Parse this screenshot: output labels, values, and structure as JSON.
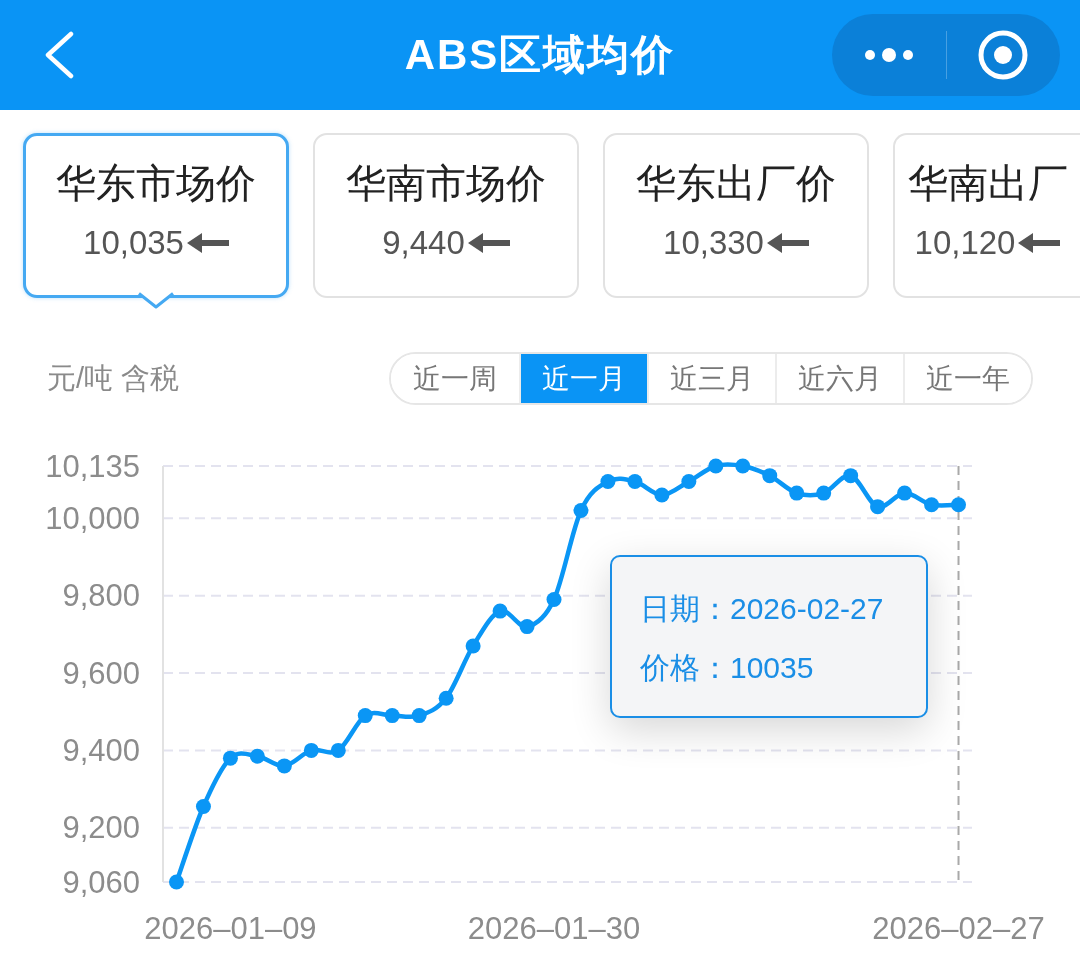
{
  "header": {
    "title": "ABS区域均价"
  },
  "cards": [
    {
      "title": "华东市场价",
      "value": "10,035",
      "selected": true
    },
    {
      "title": "华南市场价",
      "value": "9,440",
      "selected": false
    },
    {
      "title": "华东出厂价",
      "value": "10,330",
      "selected": false
    },
    {
      "title": "华南出厂",
      "value": "10,120",
      "selected": false
    }
  ],
  "unit_label": "元/吨 含税",
  "range_tabs": [
    {
      "label": "近一周",
      "selected": false
    },
    {
      "label": "近一月",
      "selected": true
    },
    {
      "label": "近三月",
      "selected": false
    },
    {
      "label": "近六月",
      "selected": false
    },
    {
      "label": "近一年",
      "selected": false
    }
  ],
  "chart": {
    "chart_data": {
      "type": "line",
      "categories": [
        null,
        null,
        "2026–01–09",
        null,
        null,
        null,
        null,
        null,
        null,
        null,
        null,
        null,
        null,
        null,
        "2026–01–30",
        null,
        null,
        null,
        null,
        null,
        null,
        null,
        null,
        null,
        null,
        null,
        null,
        null,
        null,
        "2026–02–27"
      ],
      "series": [
        {
          "color": "#0a96f5",
          "marker": "circle",
          "values": [
            9060,
            9255,
            9380,
            9385,
            9360,
            9400,
            9400,
            9490,
            9490,
            9490,
            9535,
            9670,
            9760,
            9720,
            9790,
            10020,
            10095,
            10095,
            10060,
            10095,
            10135,
            10135,
            10110,
            10065,
            10065,
            10110,
            10030,
            10065,
            10035,
            10035
          ]
        }
      ],
      "ylim": [
        9060,
        10135
      ],
      "yticks": [
        {
          "value": 9060,
          "label": "9,060"
        },
        {
          "value": 9200,
          "label": "9,200"
        },
        {
          "value": 9400,
          "label": "9,400"
        },
        {
          "value": 9600,
          "label": "9,600"
        },
        {
          "value": 9800,
          "label": "9,800"
        },
        {
          "value": 10000,
          "label": "10,000"
        },
        {
          "value": 10135,
          "label": "10,135"
        }
      ],
      "grid": true
    },
    "tooltip": {
      "lines": [
        "日期：2026-02-27",
        "价格：10035"
      ]
    }
  }
}
